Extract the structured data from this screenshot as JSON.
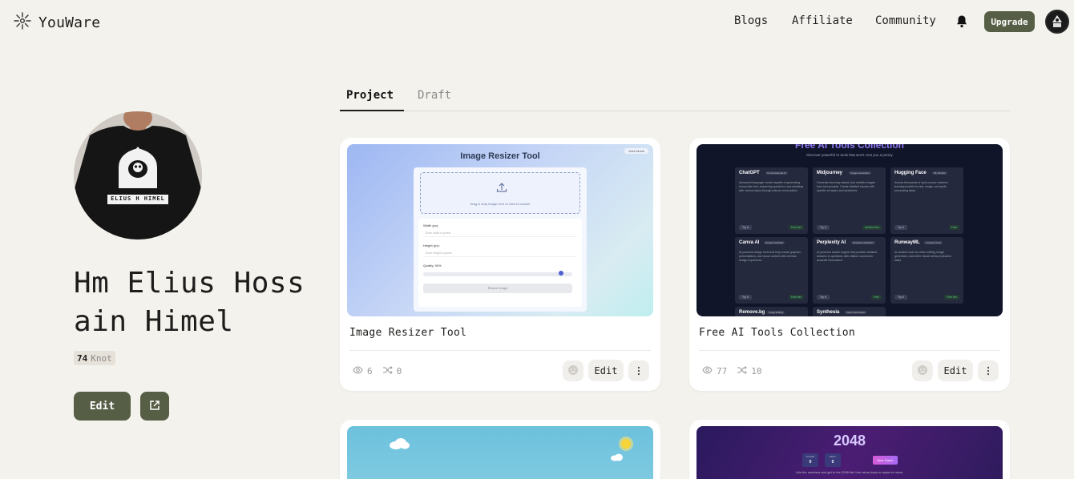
{
  "header": {
    "brand": "YouWare",
    "nav": [
      {
        "label": "Blogs"
      },
      {
        "label": "Affiliate"
      },
      {
        "label": "Community"
      }
    ],
    "upgrade_label": "Upgrade"
  },
  "profile": {
    "name": "Hm Elius Hossain Himel",
    "shirt_text": "ELIUS H HIMEL",
    "knot_count": "74",
    "knot_unit": "Knot",
    "edit_label": "Edit"
  },
  "tabs": [
    {
      "label": "Project",
      "active": true
    },
    {
      "label": "Draft",
      "active": false
    }
  ],
  "projects": [
    {
      "title": "Image Resizer Tool",
      "views": "6",
      "remixes": "0",
      "edit_label": "Edit",
      "preview": {
        "heading": "Image Resizer Tool",
        "mode_toggle": "Dark Mode",
        "drop_text": "Drag & drop image here or click to browse",
        "width_label": "Width (px):",
        "width_placeholder": "Enter width in pixels",
        "height_label": "Height (px):",
        "height_placeholder": "Enter height in pixels",
        "quality_label": "Quality: 90%",
        "resize_label": "Resize Image"
      }
    },
    {
      "title": "Free AI Tools Collection",
      "views": "77",
      "remixes": "10",
      "edit_label": "Edit",
      "preview": {
        "heading": "Free AI Tools Collection",
        "subheading": "Discover powerful AI tools that won't cost you a penny",
        "tools": [
          {
            "name": "ChatGPT",
            "tag": "Conversational AI",
            "desc": "Advanced language model capable of generating human-like text, answering questions, and assisting with various tasks through natural conversation.",
            "try": "Try it",
            "price": "Free tier"
          },
          {
            "name": "Midjourney",
            "tag": "Image Generation",
            "desc": "Generate stunning artwork and realistic images from text prompts. Create detailed visuals with specific art styles and aesthetics.",
            "try": "Try it",
            "price": "Limited free"
          },
          {
            "name": "Hugging Face",
            "tag": "ML Models",
            "desc": "Access thousands of open-source machine learning models for text, image, and audio processing tasks.",
            "try": "Try it",
            "price": "Free"
          },
          {
            "name": "Canva AI",
            "tag": "Design Assistant",
            "desc": "AI-powered design tools that help create graphics, presentations, and visual content with minimal design experience.",
            "try": "Try it",
            "price": "Free tier"
          },
          {
            "name": "Perplexity AI",
            "tag": "Research Assistant",
            "desc": "AI-powered search engine that provides detailed answers to questions with citation sources for accurate information.",
            "try": "Try it",
            "price": "Free"
          },
          {
            "name": "RunwayML",
            "tag": "Creative Tools",
            "desc": "AI creative tools for video editing, image generation, and other visual media production tasks.",
            "try": "Try it",
            "price": "Free tier"
          },
          {
            "name": "Remove.bg",
            "tag": "Image Editing"
          },
          {
            "name": "Synthesia",
            "tag": "Video Generation"
          }
        ]
      }
    },
    {
      "title": "",
      "preview": {}
    },
    {
      "title": "",
      "preview": {
        "heading": "2048",
        "score_label": "SCORE",
        "score_value": "0",
        "best_label": "BEST",
        "best_value": "0",
        "new_game_label": "New Game",
        "tip": "Join the numbers and get to the 2048 tile! Use arrow keys or swipe to move."
      }
    }
  ]
}
